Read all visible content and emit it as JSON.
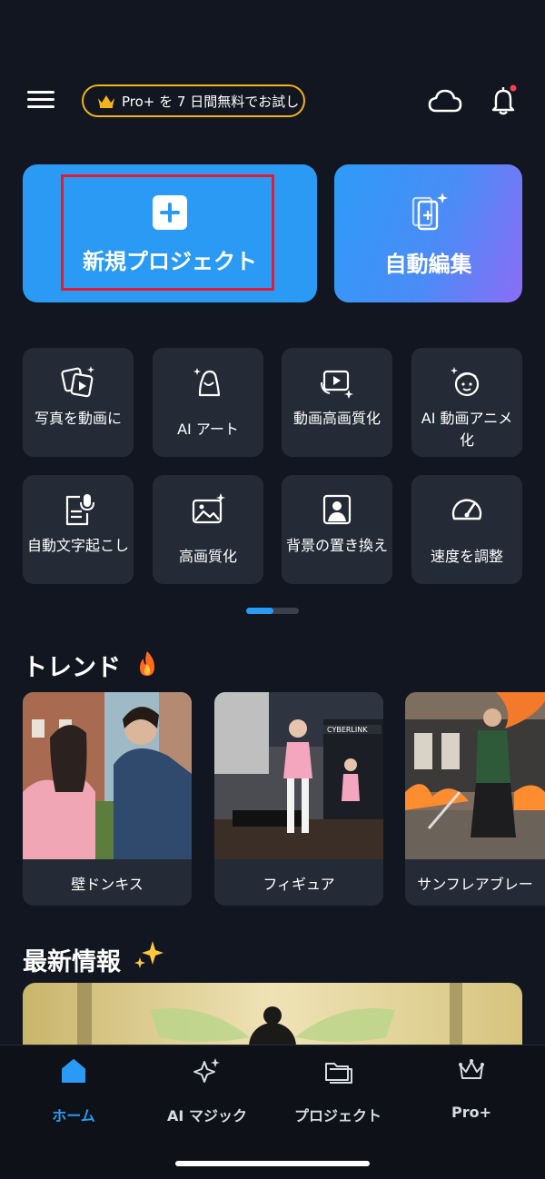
{
  "header": {
    "promo_label": "Pro+ を 7 日間無料でお試し",
    "menu_icon": "menu-icon",
    "cloud_icon": "cloud-icon",
    "bell_icon": "bell-icon"
  },
  "hero": {
    "new_project_label": "新規プロジェクト",
    "auto_edit_label": "自動編集"
  },
  "tools": [
    {
      "label": "写真を動画に",
      "icon": "photo-to-video-icon"
    },
    {
      "label": "AI アート",
      "icon": "ai-art-icon"
    },
    {
      "label": "動画高画質化",
      "icon": "video-enhance-icon"
    },
    {
      "label": "AI 動画アニメ化",
      "icon": "ai-anime-icon"
    },
    {
      "label": "自動文字起こし",
      "icon": "transcribe-icon"
    },
    {
      "label": "高画質化",
      "icon": "image-enhance-icon"
    },
    {
      "label": "背景の置き換え",
      "icon": "background-replace-icon"
    },
    {
      "label": "速度を調整",
      "icon": "speed-icon"
    }
  ],
  "trend": {
    "title": "トレンド",
    "items": [
      {
        "label": "壁ドンキス"
      },
      {
        "label": "フィギュア"
      },
      {
        "label": "サンフレアブレー"
      }
    ]
  },
  "news": {
    "title": "最新情報"
  },
  "nav": [
    {
      "label": "ホーム",
      "icon": "home-icon",
      "active": true
    },
    {
      "label": "AI マジック",
      "icon": "ai-magic-icon"
    },
    {
      "label": "プロジェクト",
      "icon": "folder-icon"
    },
    {
      "label": "Pro+",
      "icon": "crown-icon"
    }
  ],
  "colors": {
    "background": "#121620",
    "accent": "#2a9af5",
    "card": "#252b36",
    "promo_border": "#f2b418",
    "highlight": "#e8192c"
  }
}
